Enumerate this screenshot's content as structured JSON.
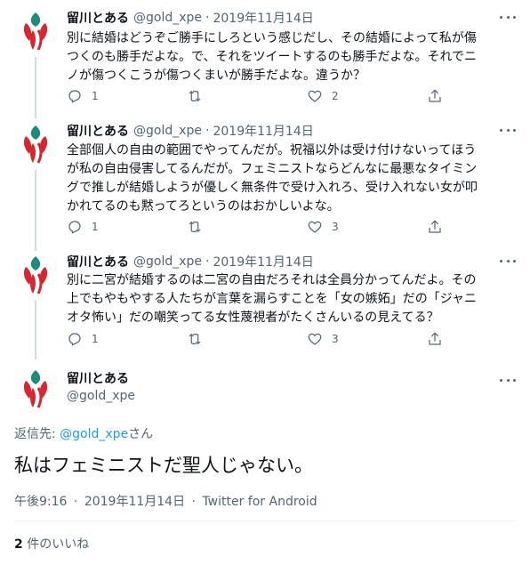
{
  "colors": {
    "accent": "#1d9bf0",
    "secondary_text": "#536471",
    "primary_text": "#0f1419",
    "thread_line": "#cfd9de",
    "logo_red": "#d8262f",
    "logo_teal": "#1d8a7a"
  },
  "tweets": [
    {
      "name": "留川とある",
      "handle": "@gold_xpe",
      "dot": "·",
      "date": "2019年11月14日",
      "lines": [
        "別に結婚はどうぞご勝手にしろという感じだし、その結婚によって私が傷",
        "つくのも勝手だよな。で、それをツイートするのも勝手だよな。それでニ",
        "ノが傷つくこうが傷つくまいが勝手だよな。違うか？"
      ],
      "replies": "1",
      "retweets": "",
      "likes": "2"
    },
    {
      "name": "留川とある",
      "handle": "@gold_xpe",
      "dot": "·",
      "date": "2019年11月14日",
      "lines": [
        "全部個人の自由の範囲でやってんだが。祝福以外は受け付けないってほう",
        "が私の自由侵害してるんだが。フェミニストならどんなに最悪なタイミン",
        "グで推しが結婚しようが優しく無条件で受け入れろ、受け入れない女が叩",
        "かれてるのも黙ってろというのはおかしいよな。"
      ],
      "replies": "1",
      "retweets": "",
      "likes": "3"
    },
    {
      "name": "留川とある",
      "handle": "@gold_xpe",
      "dot": "·",
      "date": "2019年11月14日",
      "lines": [
        "別に二宮が結婚するのは二宮の自由だろそれは全員分かってんだよ。その",
        "上でもやもやする人たちが言葉を漏らすことを「女の嫉妬」だの「ジャニ",
        "オタ怖い」だの嘲笑ってる女性蔑視者がたくさんいるの見えてる？"
      ],
      "replies": "1",
      "retweets": "",
      "likes": "3"
    }
  ],
  "main_tweet": {
    "name": "留川とある",
    "handle": "@gold_xpe",
    "reply_prefix": "返信先: ",
    "reply_handle": "@gold_xpe",
    "reply_suffix": "さん",
    "text": "私はフェミニストだ聖人じゃない。",
    "time": "午後9:16",
    "dot": "·",
    "date": "2019年11月14日",
    "source": "Twitter for Android",
    "like_count": "2",
    "like_label": " 件のいいね"
  },
  "icons": {
    "reply": "reply-icon",
    "retweet": "retweet-icon",
    "like": "heart-icon",
    "share": "share-icon",
    "more": "more-icon"
  }
}
